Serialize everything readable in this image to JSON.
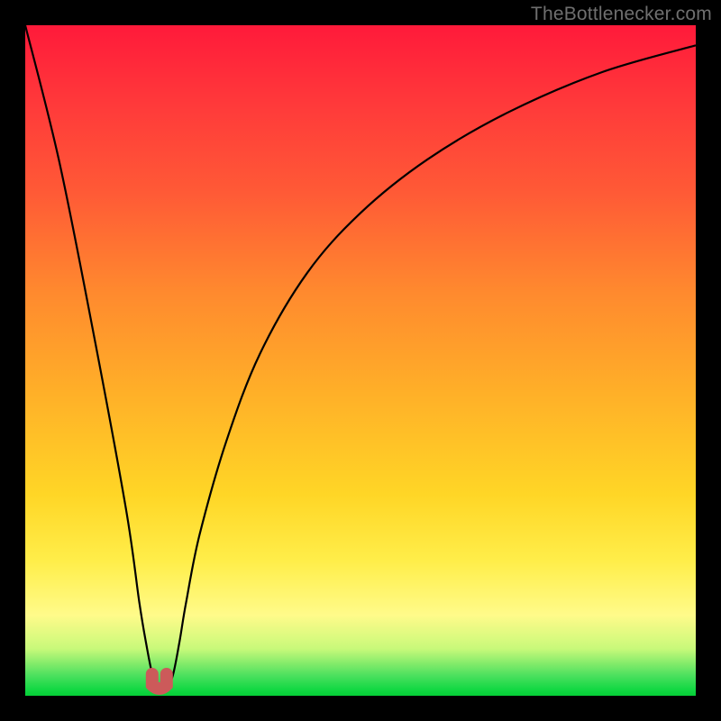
{
  "watermark": "TheBottlenecker.com",
  "chart_data": {
    "type": "line",
    "title": "",
    "xlabel": "",
    "ylabel": "",
    "xlim": [
      0,
      100
    ],
    "ylim": [
      0,
      100
    ],
    "series": [
      {
        "name": "bottleneck-curve",
        "x": [
          0,
          5,
          10,
          15,
          17,
          18,
          19,
          20,
          21,
          22,
          23,
          24,
          26,
          30,
          35,
          42,
          50,
          60,
          72,
          86,
          100
        ],
        "values": [
          100,
          80,
          55,
          28,
          14,
          8,
          3,
          1,
          1,
          3,
          8,
          14,
          24,
          38,
          51,
          63,
          72,
          80,
          87,
          93,
          97
        ]
      }
    ],
    "dip_x": 20,
    "dip_value": 1,
    "gradient_stops": [
      {
        "pct": 0,
        "color": "#ff1a3a"
      },
      {
        "pct": 50,
        "color": "#ffb028"
      },
      {
        "pct": 88,
        "color": "#fffb8a"
      },
      {
        "pct": 100,
        "color": "#05cf37"
      }
    ]
  }
}
